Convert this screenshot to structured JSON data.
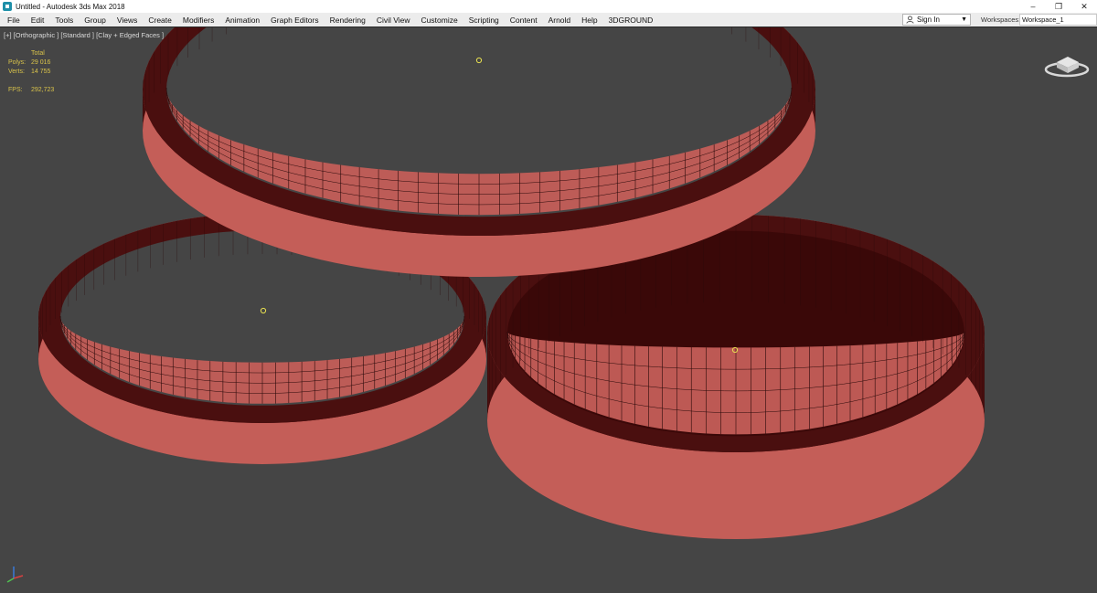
{
  "window": {
    "title": "Untitled - Autodesk 3ds Max 2018",
    "controls": {
      "minimize": "–",
      "restore": "❐",
      "close": "✕"
    }
  },
  "menubar": {
    "items": [
      "File",
      "Edit",
      "Tools",
      "Group",
      "Views",
      "Create",
      "Modifiers",
      "Animation",
      "Graph Editors",
      "Rendering",
      "Civil View",
      "Customize",
      "Scripting",
      "Content",
      "Arnold",
      "Help",
      "3DGROUND"
    ],
    "sign_in": "Sign In",
    "workspaces_label": "Workspaces:",
    "workspace_value": "Workspace_1"
  },
  "viewport": {
    "label": "[+] [Orthographic ] [Standard ] [Clay + Edged Faces ]",
    "stats": {
      "header": "Total",
      "polys_label": "Polys:",
      "polys_value": "29 016",
      "verts_label": "Verts:",
      "verts_value": "14 755",
      "fps_label": "FPS:",
      "fps_value": "292,723"
    }
  },
  "colors": {
    "background": "#454545",
    "mesh_face": "#c45e58",
    "mesh_dark": "#4a0f0f",
    "wire": "#2a0a0a",
    "pivot": "#e8e050",
    "stats_text": "#d9c34a"
  },
  "icons": [
    "app-icon",
    "user-icon",
    "viewcube-icon",
    "axis-gizmo-icon"
  ]
}
